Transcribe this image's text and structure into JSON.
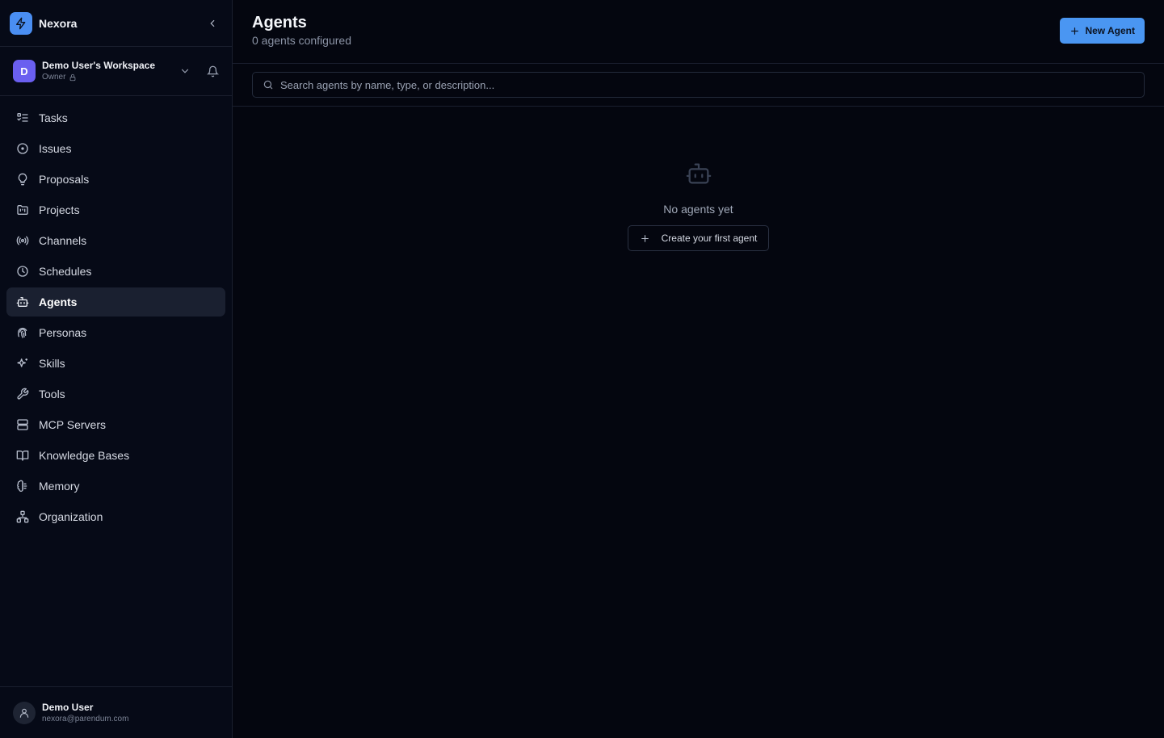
{
  "brand": {
    "name": "Nexora",
    "accent": "#4a8ef2"
  },
  "workspace": {
    "initial": "D",
    "name": "Demo User's Workspace",
    "role": "Owner",
    "avatar_color": "#6a5ff0"
  },
  "sidebar": {
    "items": [
      {
        "label": "Tasks",
        "icon": "list-icon"
      },
      {
        "label": "Issues",
        "icon": "circle-dot-icon"
      },
      {
        "label": "Proposals",
        "icon": "lightbulb-icon"
      },
      {
        "label": "Projects",
        "icon": "folder-kanban-icon"
      },
      {
        "label": "Channels",
        "icon": "radio-icon"
      },
      {
        "label": "Schedules",
        "icon": "clock-icon"
      },
      {
        "label": "Agents",
        "icon": "bot-icon",
        "active": true
      },
      {
        "label": "Personas",
        "icon": "fingerprint-icon"
      },
      {
        "label": "Skills",
        "icon": "sparkles-icon"
      },
      {
        "label": "Tools",
        "icon": "wrench-icon"
      },
      {
        "label": "MCP Servers",
        "icon": "server-icon"
      },
      {
        "label": "Knowledge Bases",
        "icon": "book-open-icon"
      },
      {
        "label": "Memory",
        "icon": "brain-icon"
      },
      {
        "label": "Organization",
        "icon": "network-icon"
      }
    ]
  },
  "user": {
    "name": "Demo User",
    "email": "nexora@parendum.com"
  },
  "header": {
    "title": "Agents",
    "subtitle": "0 agents configured",
    "new_button": "New Agent"
  },
  "search": {
    "placeholder": "Search agents by name, type, or description..."
  },
  "empty_state": {
    "text": "No agents yet",
    "button": "Create your first agent"
  }
}
